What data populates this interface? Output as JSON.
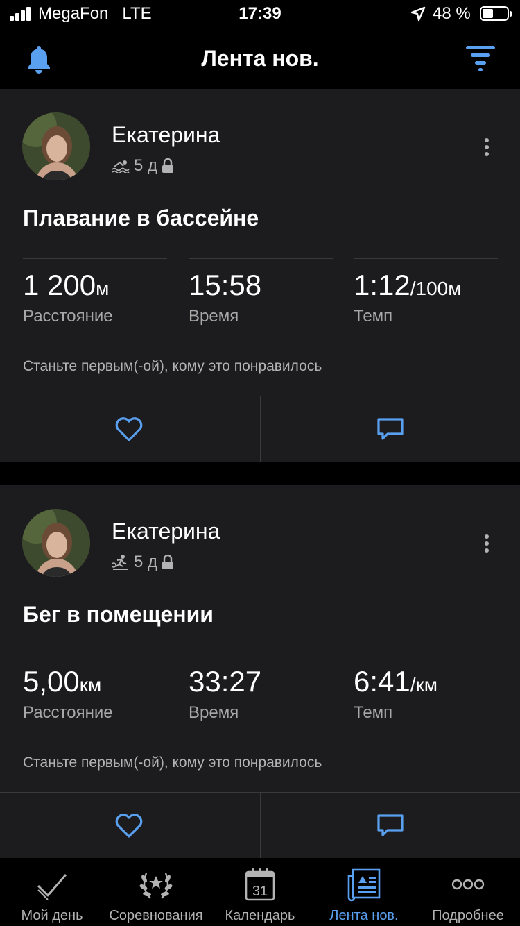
{
  "status_bar": {
    "carrier": "MegaFon",
    "network": "LTE",
    "time": "17:39",
    "battery": "48 %"
  },
  "header": {
    "title": "Лента нов.",
    "left_icon": "bell-icon",
    "right_icon": "filter-icon"
  },
  "posts": [
    {
      "user": "Екатерина",
      "activity_icon": "swim-icon",
      "ago": "5 д",
      "title": "Плавание в бассейне",
      "stats": [
        {
          "value": "1 200",
          "unit": "м",
          "label": "Расстояние"
        },
        {
          "value": "15:58",
          "unit": "",
          "label": "Время"
        },
        {
          "value": "1:12",
          "unit": "/100м",
          "label": "Темп"
        }
      ],
      "likes_text": "Станьте первым(-ой), кому это понравилось"
    },
    {
      "user": "Екатерина",
      "activity_icon": "treadmill-run-icon",
      "ago": "5 д",
      "title": "Бег в помещении",
      "stats": [
        {
          "value": "5,00",
          "unit": "км",
          "label": "Расстояние"
        },
        {
          "value": "33:27",
          "unit": "",
          "label": "Время"
        },
        {
          "value": "6:41",
          "unit": "/км",
          "label": "Темп"
        }
      ],
      "likes_text": "Станьте первым(-ой), кому это понравилось"
    }
  ],
  "tabs": [
    {
      "label": "Мой день",
      "icon": "checkmark-icon"
    },
    {
      "label": "Соревнования",
      "icon": "laurel-icon"
    },
    {
      "label": "Календарь",
      "icon": "calendar-icon",
      "day": "31"
    },
    {
      "label": "Лента нов.",
      "icon": "newsfeed-icon",
      "active": true
    },
    {
      "label": "Подробнее",
      "icon": "more-dots-icon"
    }
  ],
  "colors": {
    "accent": "#5aa0f0",
    "card_bg": "#1c1c1e",
    "background": "#000000"
  }
}
